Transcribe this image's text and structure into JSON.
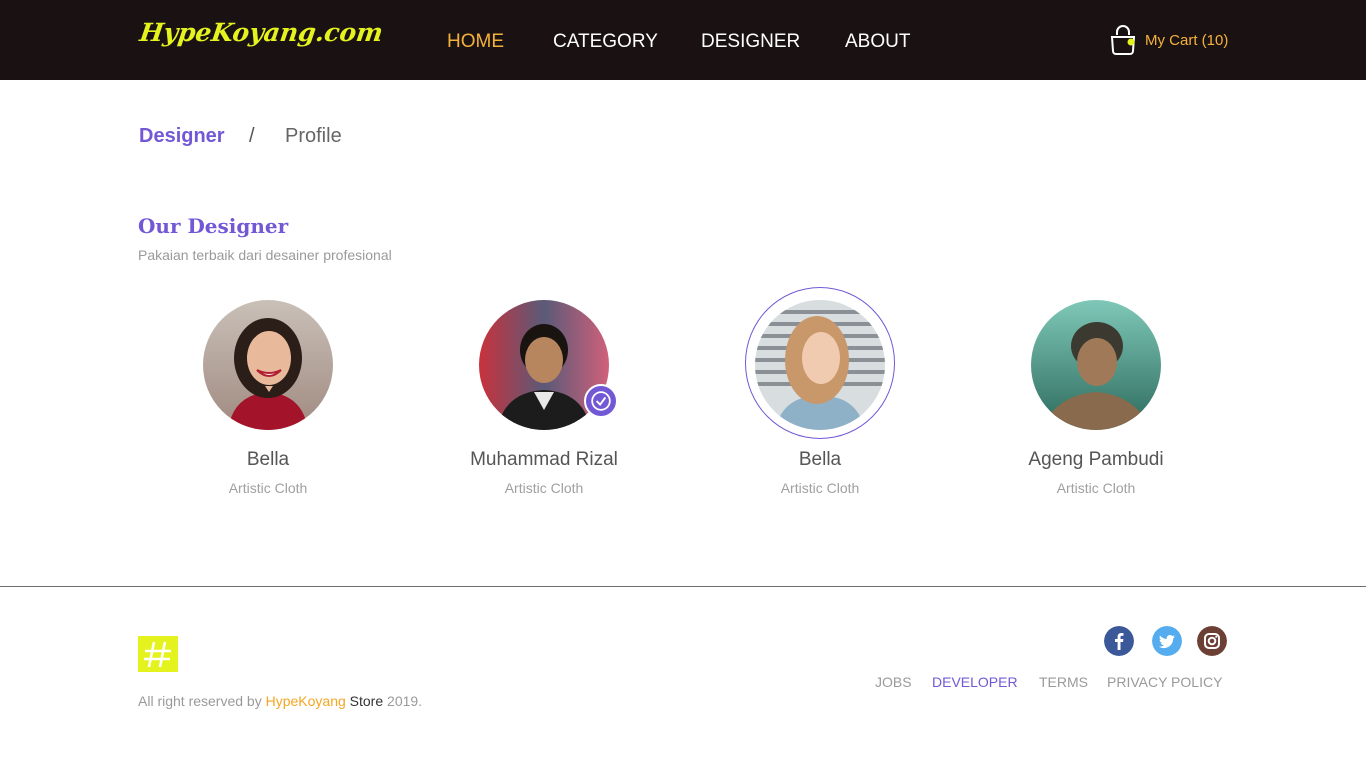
{
  "header": {
    "logo_text": "HypeKoyang.com",
    "nav": [
      {
        "label": "HOME",
        "active": true
      },
      {
        "label": "CATEGORY",
        "active": false
      },
      {
        "label": "DESIGNER",
        "active": false
      },
      {
        "label": "ABOUT",
        "active": false
      }
    ],
    "cart": {
      "label": "My Cart (10)",
      "icon": "shopping-bag-icon"
    }
  },
  "breadcrumb": {
    "items": [
      "Designer",
      "Profile"
    ],
    "separator": "/"
  },
  "section": {
    "title": "Our Designer",
    "subtitle": "Pakaian terbaik dari desainer profesional"
  },
  "designers": [
    {
      "name": "Bella",
      "role": "Artistic Cloth",
      "verified": false,
      "selected": false
    },
    {
      "name": "Muhammad Rizal",
      "role": "Artistic Cloth",
      "verified": true,
      "selected": false
    },
    {
      "name": "Bella",
      "role": "Artistic Cloth",
      "verified": false,
      "selected": true
    },
    {
      "name": "Ageng Pambudi",
      "role": "Artistic Cloth",
      "verified": false,
      "selected": false
    }
  ],
  "footer": {
    "logo_icon": "hypekoyang-hash-logo",
    "copyright_prefix": "All right reserved by ",
    "copyright_brand": "HypeKoyang",
    "copyright_store": " Store",
    "copyright_year": " 2019.",
    "social": [
      "facebook-icon",
      "twitter-icon",
      "instagram-icon"
    ],
    "links": [
      {
        "label": "JOBS",
        "accent": false
      },
      {
        "label": "DEVELOPER",
        "accent": true
      },
      {
        "label": "TERMS",
        "accent": false
      },
      {
        "label": "PRIVACY POLICY",
        "accent": false
      }
    ]
  },
  "colors": {
    "header_bg": "#1a1112",
    "logo": "#e4f21d",
    "nav_active": "#f5b23a",
    "accent_purple": "#7358d6"
  }
}
